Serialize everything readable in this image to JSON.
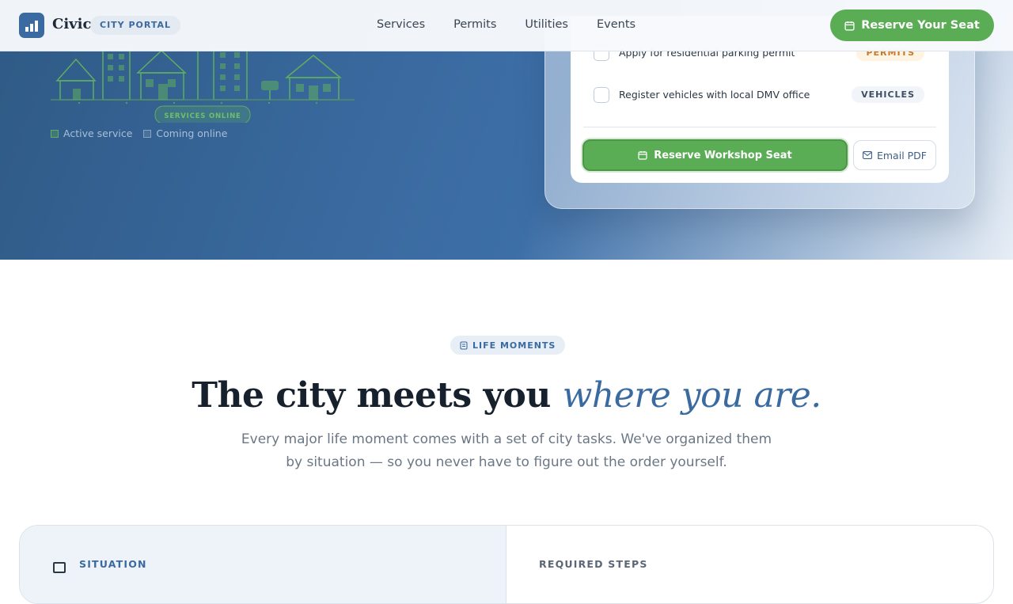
{
  "nav": {
    "brand": "Civic",
    "badge": "CITY PORTAL",
    "links": [
      "Services",
      "Permits",
      "Utilities",
      "Events"
    ],
    "cta_label": "Reserve Your Seat"
  },
  "hero": {
    "skyline_label": "SERVICES ONLINE",
    "legend": [
      {
        "label": "Active service",
        "state": "active"
      },
      {
        "label": "Coming online",
        "state": "inactive"
      }
    ],
    "card": {
      "tasks": [
        {
          "label": "Apply for residential parking permit",
          "tag": "PERMITS",
          "checked": false
        },
        {
          "label": "Register vehicles with local DMV office",
          "tag": "VEHICLES",
          "checked": false
        }
      ],
      "primary_button": "Reserve Workshop Seat",
      "secondary_button": "Email PDF"
    }
  },
  "section": {
    "eyebrow": "LIFE MOMENTS",
    "headline_main": "The city meets you",
    "headline_accent": "where you are.",
    "subtext": "Every major life moment comes with a set of city tasks. We've organized them by situation — so you never have to figure out the order yourself.",
    "panel": {
      "left_label": "SITUATION",
      "right_label": "REQUIRED STEPS"
    }
  },
  "colors": {
    "brand_blue": "#3a6aa0",
    "cta_green": "#5aac55",
    "permits_tag": "#c7782a",
    "hero_dark": "#2f5a86"
  }
}
